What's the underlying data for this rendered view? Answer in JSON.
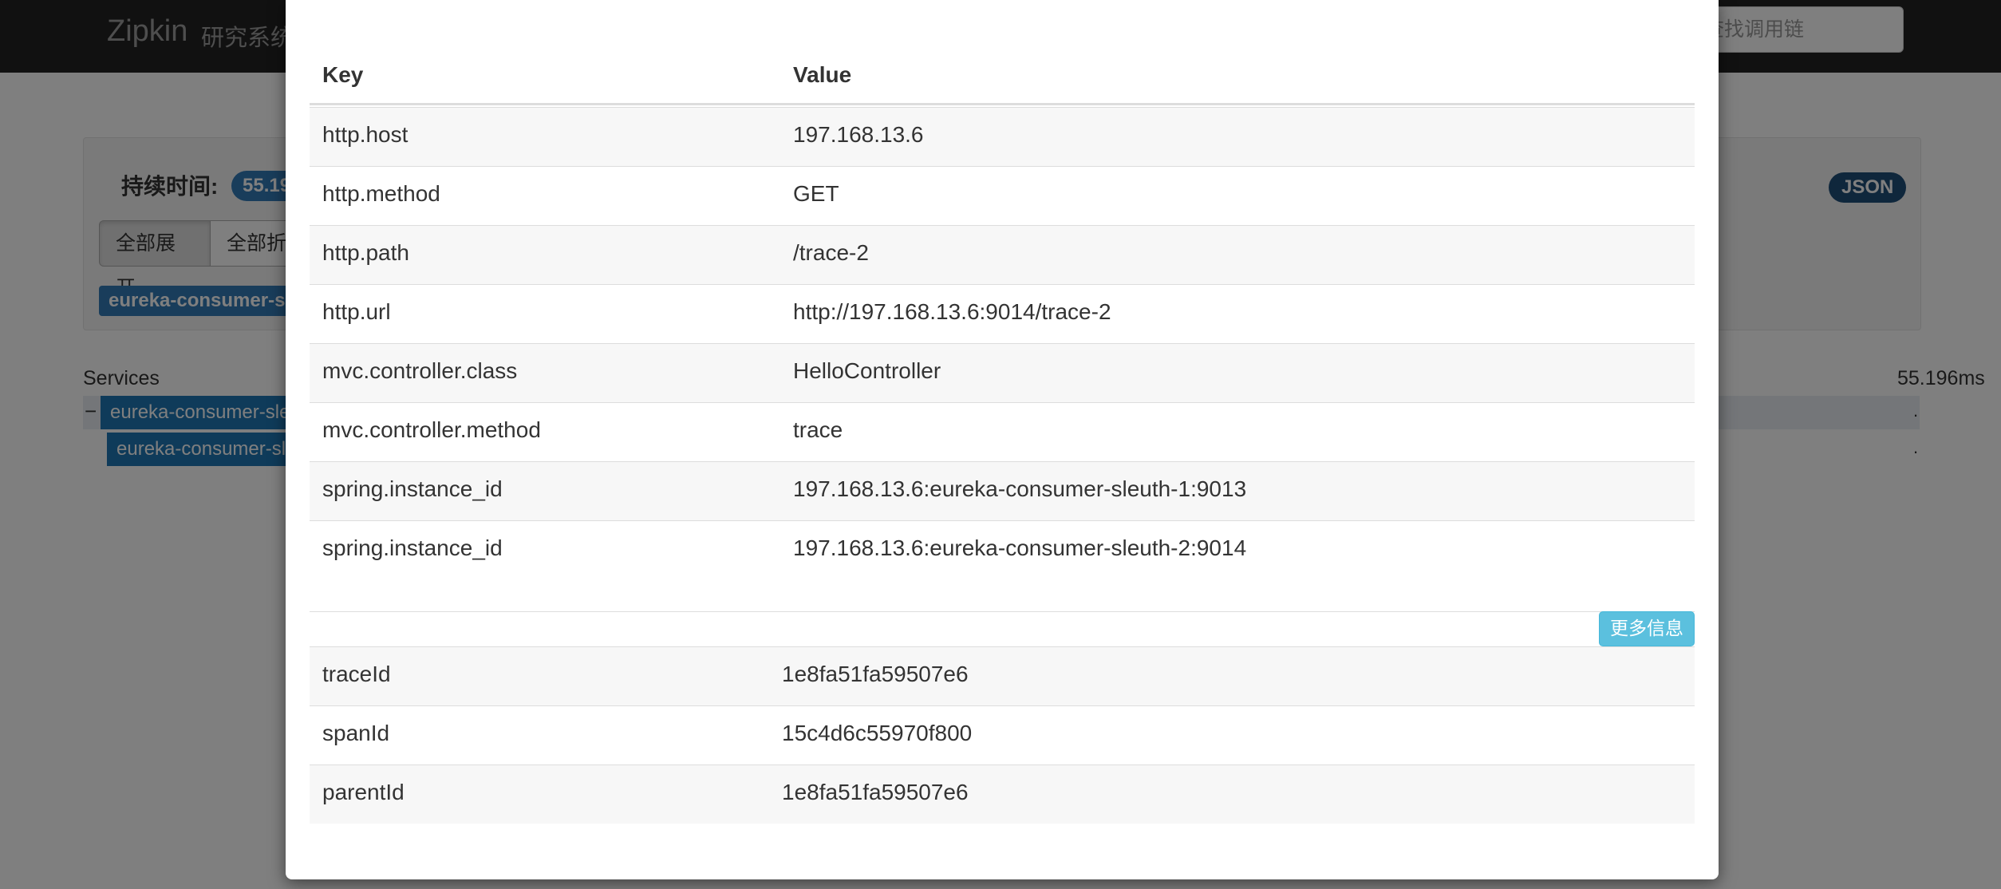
{
  "navbar": {
    "brand": "Zipkin",
    "subtitle": "研究系统",
    "search_placeholder": "ID查找调用链"
  },
  "trace_summary": {
    "duration_label": "持续时间:",
    "duration_value": "55.19",
    "expand_all_label": "全部展开",
    "collapse_all_label": "全部折",
    "service_tag": "eureka-consumer-s",
    "json_label": "JSON"
  },
  "timeline": {
    "services_label": "Services",
    "total_duration": "55.196ms",
    "collapse_symbol": "−",
    "spans": [
      {
        "service": "eureka-consumer-sle",
        "marker": "."
      },
      {
        "service": "eureka-consumer-sle",
        "marker": "."
      }
    ]
  },
  "modal": {
    "annotations_table": {
      "headers": {
        "key": "Key",
        "value": "Value"
      },
      "rows": [
        {
          "key": "http.host",
          "value": "197.168.13.6"
        },
        {
          "key": "http.method",
          "value": "GET"
        },
        {
          "key": "http.path",
          "value": "/trace-2"
        },
        {
          "key": "http.url",
          "value": "http://197.168.13.6:9014/trace-2"
        },
        {
          "key": "mvc.controller.class",
          "value": "HelloController"
        },
        {
          "key": "mvc.controller.method",
          "value": "trace"
        },
        {
          "key": "spring.instance_id",
          "value": "197.168.13.6:eureka-consumer-sleuth-1:9013"
        },
        {
          "key": "spring.instance_id",
          "value": "197.168.13.6:eureka-consumer-sleuth-2:9014"
        }
      ]
    },
    "more_info_label": "更多信息",
    "ids_table": {
      "rows": [
        {
          "key": "traceId",
          "value": "1e8fa51fa59507e6"
        },
        {
          "key": "spanId",
          "value": "15c4d6c55970f800"
        },
        {
          "key": "parentId",
          "value": "1e8fa51fa59507e6"
        }
      ]
    }
  }
}
